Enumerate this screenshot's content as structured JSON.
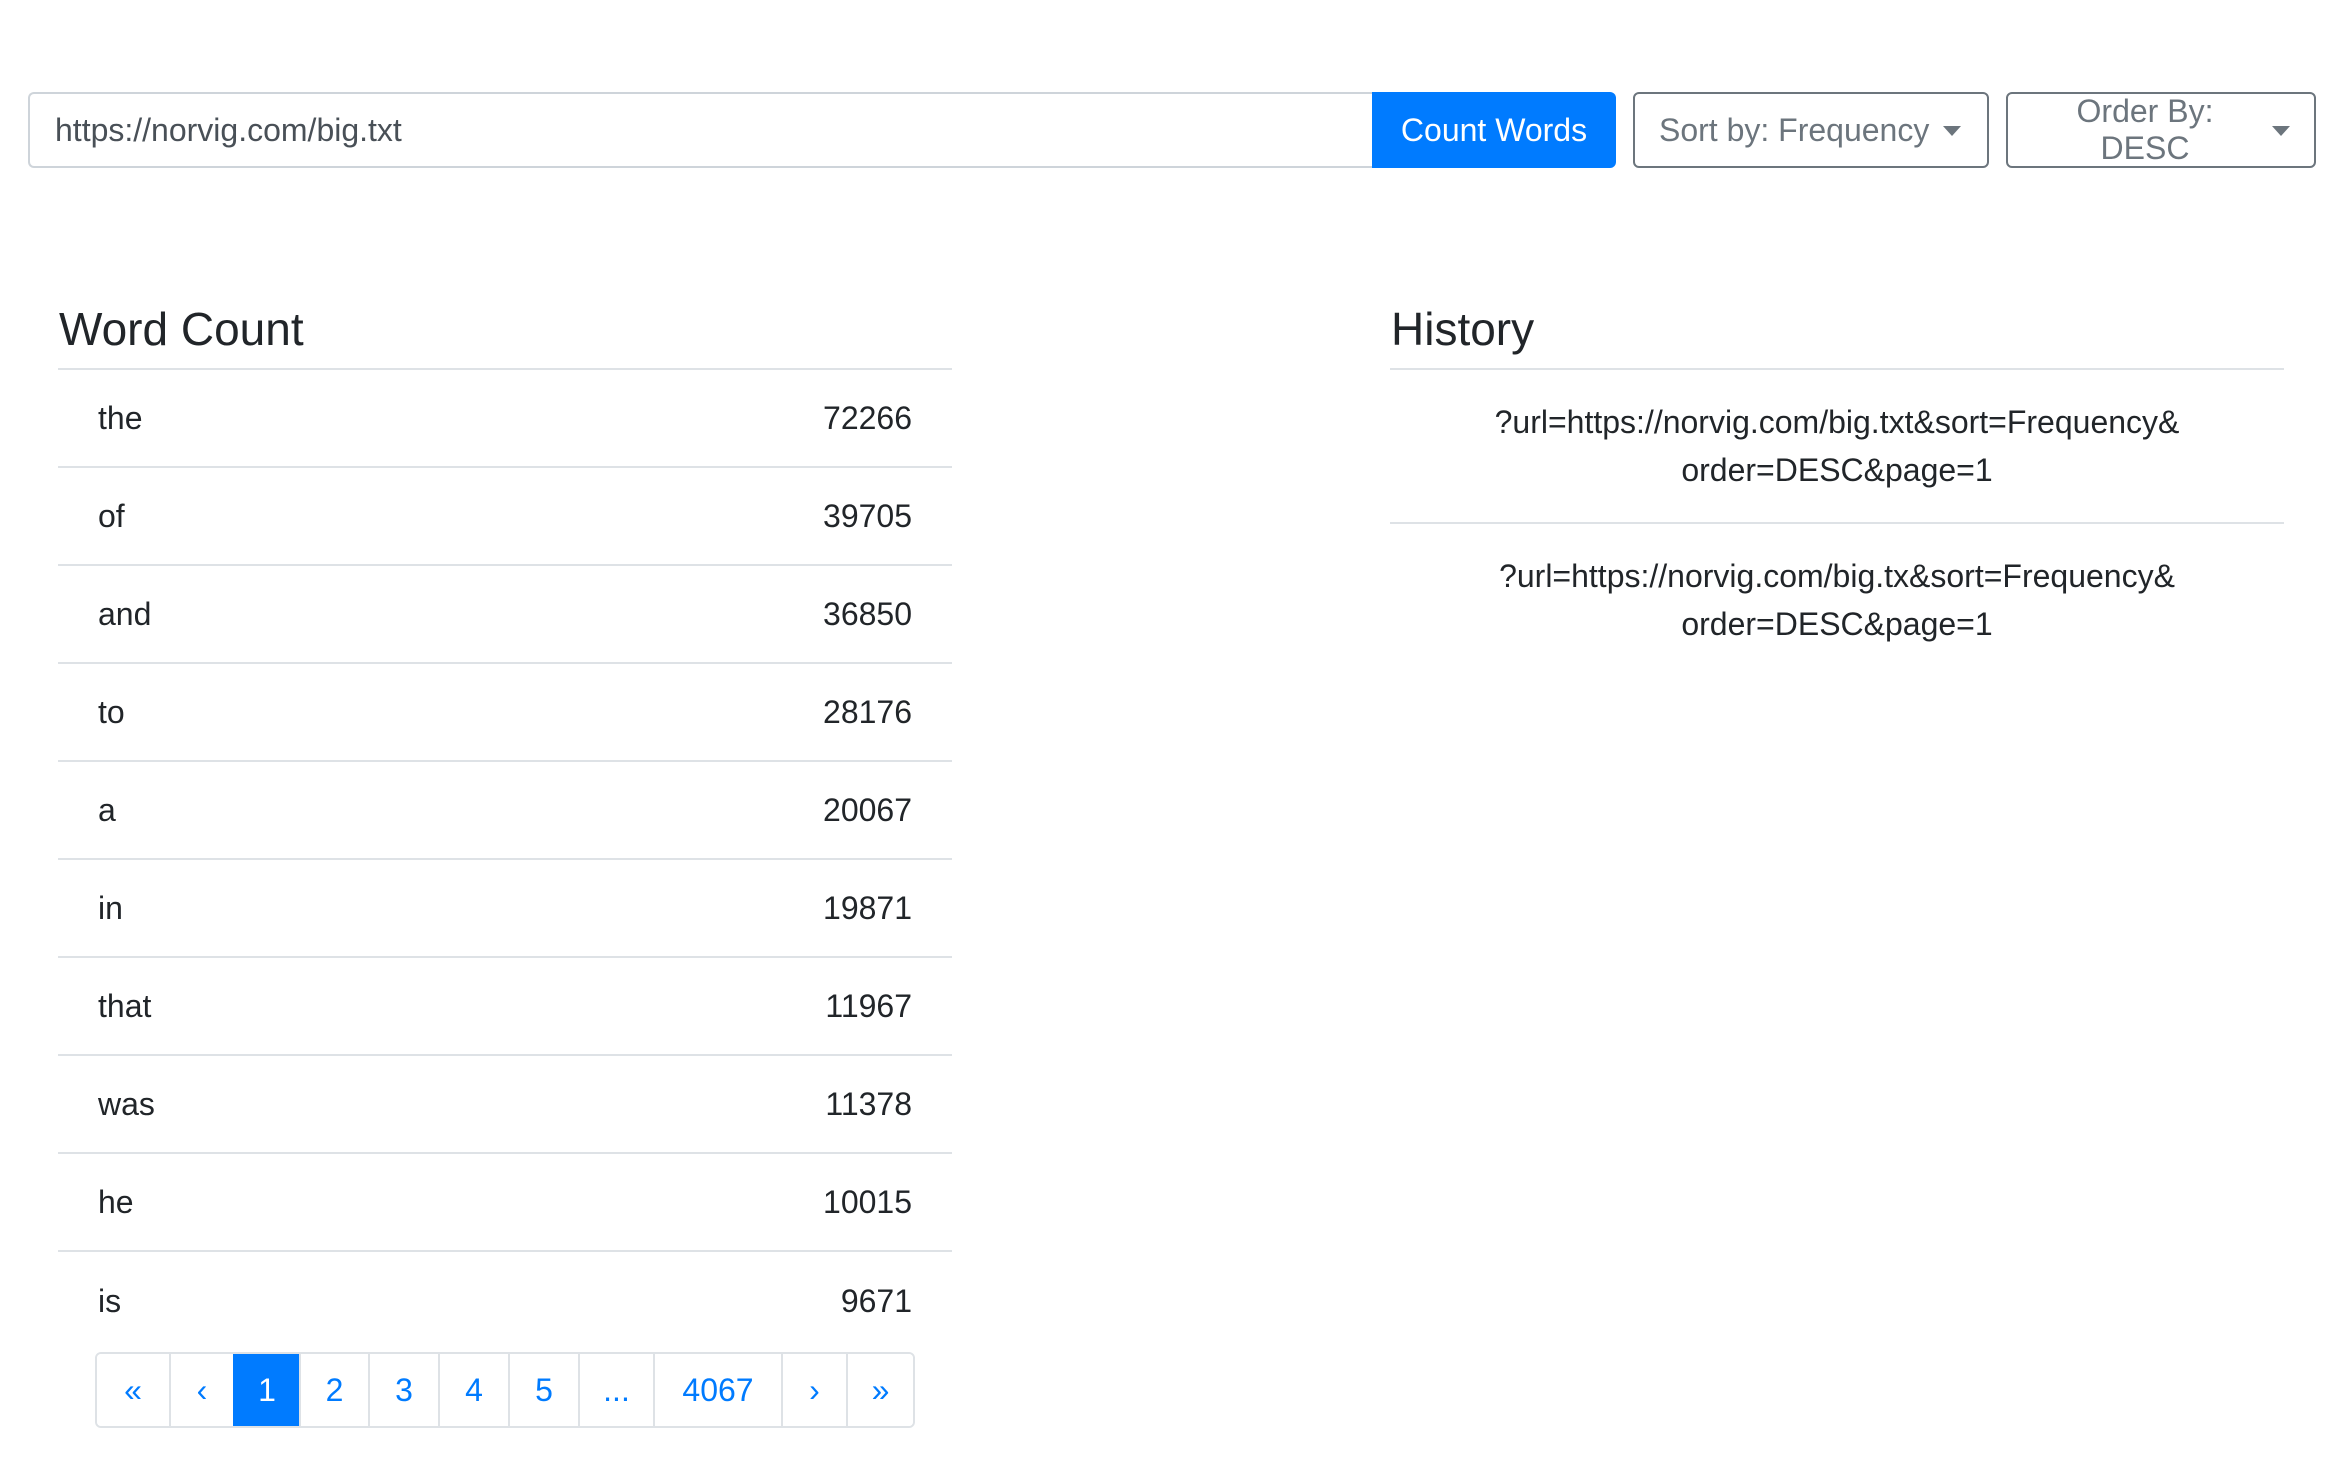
{
  "toolbar": {
    "url_value": "https://norvig.com/big.txt",
    "count_label": "Count Words",
    "sort_label": "Sort by: Frequency",
    "order_label": "Order By: DESC"
  },
  "word_count": {
    "title": "Word Count",
    "rows": [
      {
        "word": "the",
        "count": "72266"
      },
      {
        "word": "of",
        "count": "39705"
      },
      {
        "word": "and",
        "count": "36850"
      },
      {
        "word": "to",
        "count": "28176"
      },
      {
        "word": "a",
        "count": "20067"
      },
      {
        "word": "in",
        "count": "19871"
      },
      {
        "word": "that",
        "count": "11967"
      },
      {
        "word": "was",
        "count": "11378"
      },
      {
        "word": "he",
        "count": "10015"
      },
      {
        "word": "is",
        "count": "9671"
      }
    ]
  },
  "pagination": {
    "first": "«",
    "prev": "‹",
    "pages": [
      "1",
      "2",
      "3",
      "4",
      "5"
    ],
    "ellipsis": "...",
    "last_page": "4067",
    "next": "›",
    "last": "»",
    "active": "1"
  },
  "history": {
    "title": "History",
    "items": [
      {
        "line1": "?url=https://norvig.com/big.txt&sort=Frequency&",
        "line2": "order=DESC&page=1"
      },
      {
        "line1": "?url=https://norvig.com/big.tx&sort=Frequency&",
        "line2": "order=DESC&page=1"
      }
    ]
  },
  "colors": {
    "primary": "#007bff",
    "border": "#dee2e6",
    "secondary": "#6c757d"
  }
}
